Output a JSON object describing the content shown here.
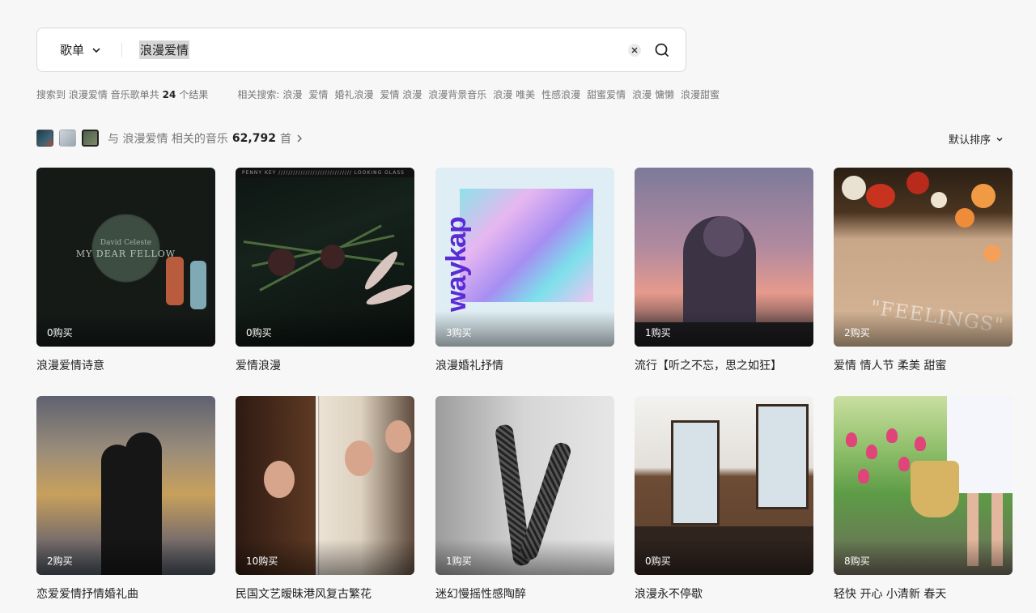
{
  "search": {
    "type_label": "歌单",
    "query": "浪漫爱情"
  },
  "meta": {
    "prefix": "搜索到 浪漫爱情 音乐歌单共",
    "count": "24",
    "suffix": "个结果",
    "related_label": "相关搜索:",
    "related_tags": [
      "浪漫",
      "爱情",
      "婚礼浪漫",
      "爱情 浪漫",
      "浪漫背景音乐",
      "浪漫 唯美",
      "性感浪漫",
      "甜蜜爱情",
      "浪漫 慵懒",
      "浪漫甜蜜"
    ]
  },
  "summary": {
    "prefix": "与 浪漫爱情 相关的音乐",
    "count": "62,792",
    "suffix": "首",
    "thumb_colors": [
      "#2c4a5a",
      "#b8c0c8",
      "#5a6a52"
    ]
  },
  "sort": {
    "label": "默认排序"
  },
  "playlists": [
    {
      "title": "浪漫爱情诗意",
      "buy": "0购买",
      "cover_text": "David Celeste",
      "cover_text2": "MY DEAR FELLOW"
    },
    {
      "title": "爱情浪漫",
      "buy": "0购买",
      "cover_text": "PENNY KEY ////////////////////////////// LOOKING GLASS"
    },
    {
      "title": "浪漫婚礼抒情",
      "buy": "3购买",
      "cover_text": "waykap"
    },
    {
      "title": "流行【听之不忘，思之如狂】",
      "buy": "1购买"
    },
    {
      "title": "爱情 情人节 柔美 甜蜜",
      "buy": "2购买",
      "cover_text": "\"FEELINGS\""
    },
    {
      "title": "恋爱爱情抒情婚礼曲",
      "buy": "2购买"
    },
    {
      "title": "民国文艺暧昧港风复古繁花",
      "buy": "10购买"
    },
    {
      "title": "迷幻慢摇性感陶醉",
      "buy": "1购买"
    },
    {
      "title": "浪漫永不停歇",
      "buy": "0购买"
    },
    {
      "title": "轻快 开心 小清新 春天",
      "buy": "8购买"
    }
  ]
}
